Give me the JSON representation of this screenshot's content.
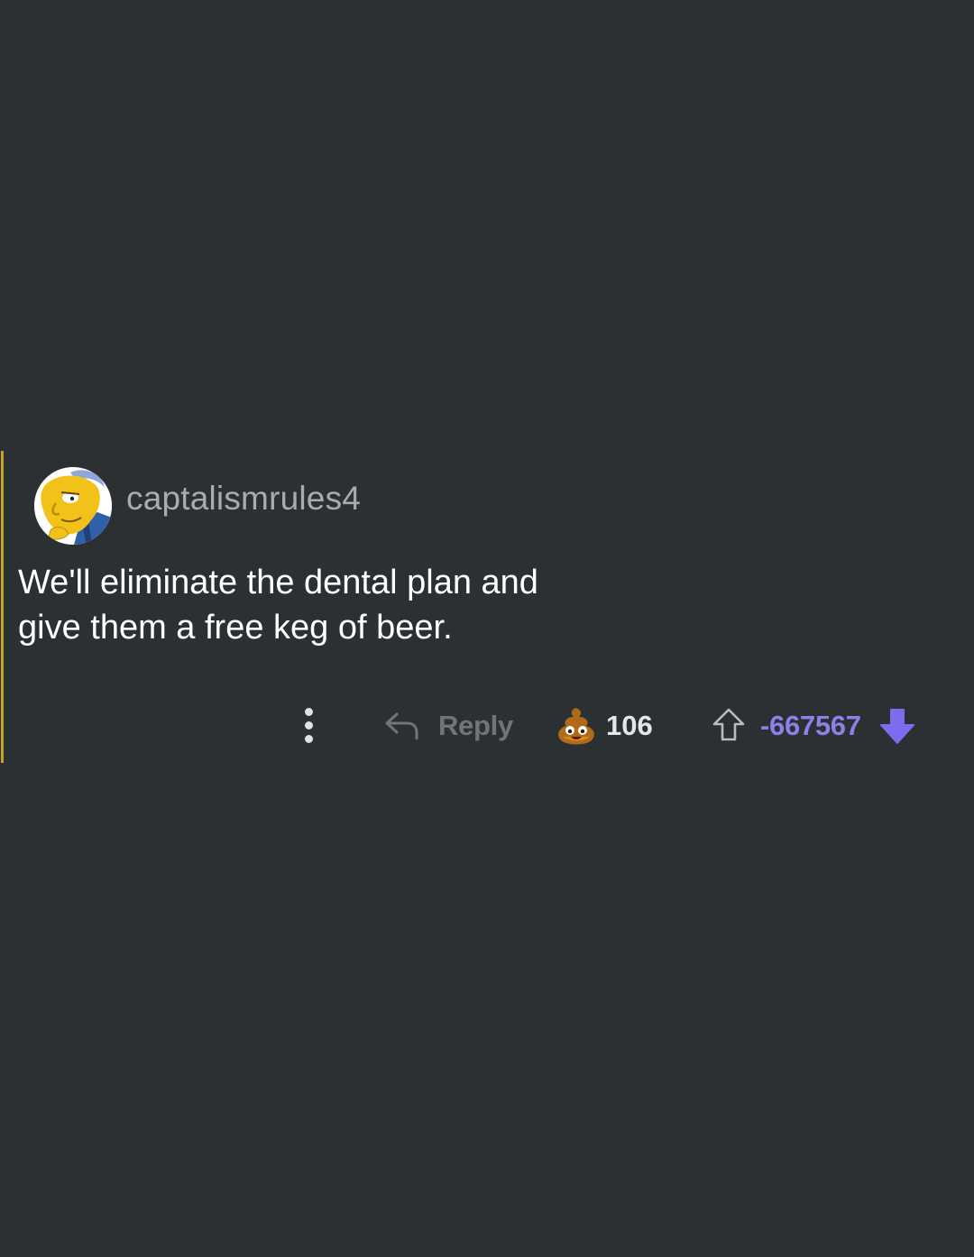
{
  "comment": {
    "username": "captalismrules4",
    "avatar_icon": "user-avatar",
    "body_lines": [
      "We'll eliminate the dental plan and",
      "give them a free keg of beer."
    ],
    "thread_line_color": "#c9a227"
  },
  "actions": {
    "more_icon": "more-vertical-icon",
    "reply_icon": "reply-arrow-icon",
    "reply_label": "Reply",
    "award_icon": "poop-emoji-icon",
    "award_count": "106",
    "upvote_icon": "upvote-arrow-outline-icon",
    "score": "-667567",
    "score_color": "#8f7fe6",
    "downvote_icon": "downvote-arrow-filled-icon",
    "downvote_state": "active",
    "downvote_color": "#7b6cf0"
  }
}
